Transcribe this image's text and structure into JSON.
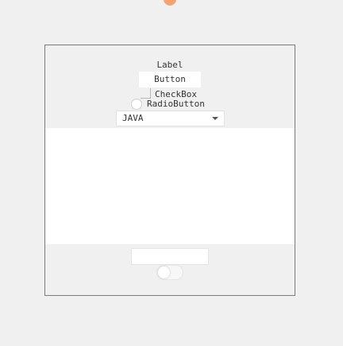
{
  "colors": {
    "accent": "#f7a371",
    "background": "#f0f0f0",
    "panel": "#ffffff",
    "border": "#7a7a7a"
  },
  "window": {
    "label_text": "Label",
    "button_label": "Button",
    "checkbox_label": "CheckBox",
    "radio_label": "RadioButton",
    "combo_value": "JAVA",
    "text_field_value": "",
    "toggle_on": false
  }
}
